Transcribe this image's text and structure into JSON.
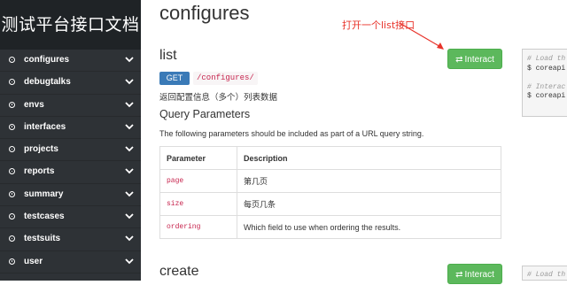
{
  "brand": "测试平台接口文档",
  "sidebar": {
    "items": [
      {
        "label": "configures"
      },
      {
        "label": "debugtalks"
      },
      {
        "label": "envs"
      },
      {
        "label": "interfaces"
      },
      {
        "label": "projects"
      },
      {
        "label": "reports"
      },
      {
        "label": "summary"
      },
      {
        "label": "testcases"
      },
      {
        "label": "testsuits"
      },
      {
        "label": "user"
      }
    ]
  },
  "main": {
    "title": "configures",
    "annotation": "打开一个list接口",
    "list_section": {
      "title": "list",
      "interact_label": "Interact",
      "method": "GET",
      "endpoint": "/configures/",
      "description": "返回配置信息（多个）列表数据",
      "query_heading": "Query Parameters",
      "query_help": "The following parameters should be included as part of a URL query string.",
      "table": {
        "headers": [
          "Parameter",
          "Description"
        ],
        "rows": [
          {
            "param": "page",
            "desc": "第几页"
          },
          {
            "param": "size",
            "desc": "每页几条"
          },
          {
            "param": "ordering",
            "desc": "Which field to use when ordering the results."
          }
        ]
      }
    },
    "create_section": {
      "title": "create",
      "interact_label": "Interact"
    },
    "code_panel_1": {
      "lines": [
        "# Load th",
        "$ coreapi",
        "",
        "# Interac",
        "$ coreapi"
      ]
    },
    "code_panel_2": {
      "lines": [
        "# Load th"
      ]
    }
  },
  "colors": {
    "sidebar_bg": "#2e3236",
    "brand_bg": "#1f2326",
    "interact_green": "#5cb85c",
    "get_badge_blue": "#3a7ab7",
    "code_red": "#c7254e",
    "annotation_red": "#e8332a"
  }
}
